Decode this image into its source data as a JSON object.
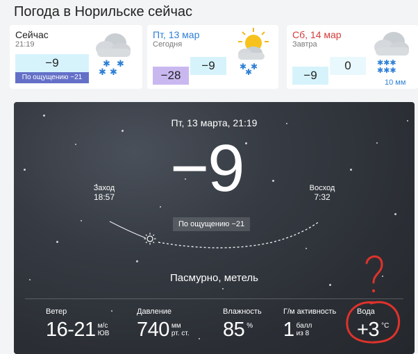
{
  "page": {
    "title": "Погода в Норильске сейчас"
  },
  "now_card": {
    "label": "Сейчас",
    "time": "21:19",
    "temp": "−9",
    "feels_like": "По ощущению −21",
    "icon": "cloud-snow-icon"
  },
  "today_card": {
    "label": "Пт, 13 мар",
    "sub": "Сегодня",
    "night_temp": "−28",
    "day_temp": "−9",
    "icon": "sun-cloud-snow-icon"
  },
  "tomorrow_card": {
    "label": "Сб, 14 мар",
    "sub": "Завтра",
    "night_temp": "−9",
    "day_temp": "0",
    "precip": "10 мм",
    "icon": "cloud-heavy-snow-icon"
  },
  "main": {
    "datetime": "Пт, 13 марта, 21:19",
    "temp": "−9",
    "feels_like": "По ощущению −21",
    "sunset_label": "Заход",
    "sunset_time": "18:57",
    "sunrise_label": "Восход",
    "sunrise_time": "7:32",
    "condition": "Пасмурно, метель"
  },
  "stats": {
    "wind": {
      "label": "Ветер",
      "value": "16-21",
      "unit1": "м/с",
      "unit2": "ЮВ"
    },
    "pressure": {
      "label": "Давление",
      "value": "740",
      "unit1": "мм",
      "unit2": "рт. ст."
    },
    "humidity": {
      "label": "Влажность",
      "value": "85",
      "unit1": "%"
    },
    "geomag": {
      "label": "Г/м активность",
      "value": "1",
      "unit1": "балл",
      "unit2": "из 8"
    },
    "water": {
      "label": "Вода",
      "value": "+3",
      "unit1": "°C"
    }
  },
  "annotation": {
    "mark": "?",
    "color": "#e0322b"
  },
  "colors": {
    "link_blue": "#2d7fd6",
    "weekend_red": "#d23c3c",
    "feels_badge": "#6470c8",
    "cold_box": "#d6f3fc",
    "night_box": "#c9b8f0"
  }
}
